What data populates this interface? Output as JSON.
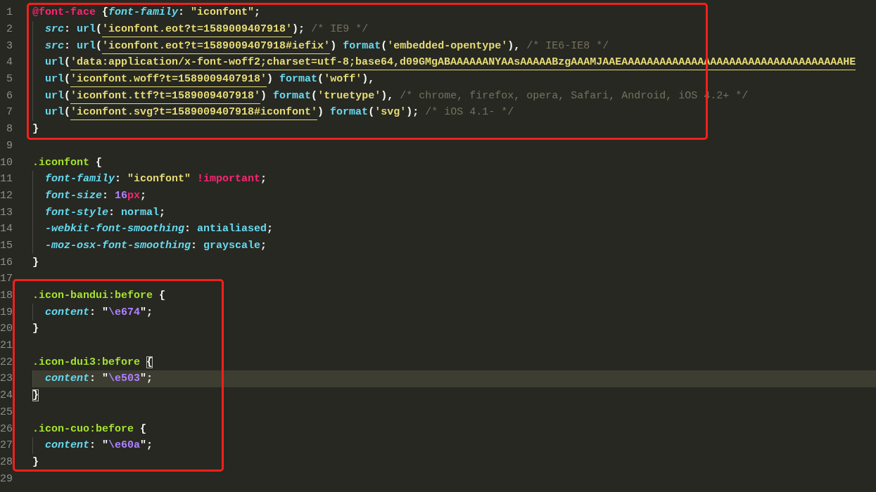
{
  "editor": {
    "groups": [
      {
        "boxed": true,
        "lines": [
          {
            "number": "1",
            "current": false,
            "indented": false,
            "tokens": [
              {
                "text": "@font-face",
                "kind": "at"
              },
              {
                "text": " {",
                "kind": "plain"
              },
              {
                "text": "font-family",
                "kind": "prop"
              },
              {
                "text": ": ",
                "kind": "plain"
              },
              {
                "text": "\"iconfont\"",
                "kind": "str"
              },
              {
                "text": ";",
                "kind": "plain"
              }
            ]
          },
          {
            "number": "2",
            "current": false,
            "indented": true,
            "tokens": [
              {
                "text": "src",
                "kind": "prop"
              },
              {
                "text": ": ",
                "kind": "plain"
              },
              {
                "text": "url",
                "kind": "func"
              },
              {
                "text": "(",
                "kind": "plain"
              },
              {
                "text": "'iconfont.eot?t=1589009407918'",
                "kind": "strmark"
              },
              {
                "text": "); ",
                "kind": "plain"
              },
              {
                "text": "/* IE9 */",
                "kind": "comment"
              }
            ]
          },
          {
            "number": "3",
            "current": false,
            "indented": true,
            "tokens": [
              {
                "text": "src",
                "kind": "prop"
              },
              {
                "text": ": ",
                "kind": "plain"
              },
              {
                "text": "url",
                "kind": "func"
              },
              {
                "text": "(",
                "kind": "plain"
              },
              {
                "text": "'iconfont.eot?t=1589009407918#iefix'",
                "kind": "strmark"
              },
              {
                "text": ") ",
                "kind": "plain"
              },
              {
                "text": "format",
                "kind": "func"
              },
              {
                "text": "(",
                "kind": "plain"
              },
              {
                "text": "'embedded-opentype'",
                "kind": "str"
              },
              {
                "text": "), ",
                "kind": "plain"
              },
              {
                "text": "/* IE6-IE8 */",
                "kind": "comment"
              }
            ]
          },
          {
            "number": "4",
            "current": false,
            "indented": true,
            "tokens": [
              {
                "text": "url",
                "kind": "func"
              },
              {
                "text": "(",
                "kind": "plain"
              },
              {
                "text": "'data:application/x-font-woff2;charset=utf-8;base64,d09GMgABAAAAAANYAAsAAAAABzgAAAMJAAEAAAAAAAAAAAAAAAAAAAAAAAAAAAAAAAAAAAHE",
                "kind": "strmark"
              }
            ]
          },
          {
            "number": "5",
            "current": false,
            "indented": true,
            "tokens": [
              {
                "text": "url",
                "kind": "func"
              },
              {
                "text": "(",
                "kind": "plain"
              },
              {
                "text": "'iconfont.woff?t=1589009407918'",
                "kind": "strmark"
              },
              {
                "text": ") ",
                "kind": "plain"
              },
              {
                "text": "format",
                "kind": "func"
              },
              {
                "text": "(",
                "kind": "plain"
              },
              {
                "text": "'woff'",
                "kind": "str"
              },
              {
                "text": "),",
                "kind": "plain"
              }
            ]
          },
          {
            "number": "6",
            "current": false,
            "indented": true,
            "tokens": [
              {
                "text": "url",
                "kind": "func"
              },
              {
                "text": "(",
                "kind": "plain"
              },
              {
                "text": "'iconfont.ttf?t=1589009407918'",
                "kind": "strmark"
              },
              {
                "text": ") ",
                "kind": "plain"
              },
              {
                "text": "format",
                "kind": "func"
              },
              {
                "text": "(",
                "kind": "plain"
              },
              {
                "text": "'truetype'",
                "kind": "str"
              },
              {
                "text": "), ",
                "kind": "plain"
              },
              {
                "text": "/* chrome, firefox, opera, Safari, Android, iOS 4.2+ */",
                "kind": "comment"
              }
            ]
          },
          {
            "number": "7",
            "current": false,
            "indented": true,
            "tokens": [
              {
                "text": "url",
                "kind": "func"
              },
              {
                "text": "(",
                "kind": "plain"
              },
              {
                "text": "'iconfont.svg?t=1589009407918#iconfont'",
                "kind": "strmark"
              },
              {
                "text": ") ",
                "kind": "plain"
              },
              {
                "text": "format",
                "kind": "func"
              },
              {
                "text": "(",
                "kind": "plain"
              },
              {
                "text": "'svg'",
                "kind": "str"
              },
              {
                "text": "); ",
                "kind": "plain"
              },
              {
                "text": "/* iOS 4.1- */",
                "kind": "comment"
              }
            ]
          },
          {
            "number": "8",
            "current": false,
            "indented": false,
            "tokens": [
              {
                "text": "}",
                "kind": "plain"
              }
            ]
          }
        ]
      },
      {
        "lines": [
          {
            "number": "9",
            "current": false,
            "indented": false
          },
          {
            "number": "10",
            "current": false,
            "indented": false,
            "tokens": [
              {
                "text": ".iconfont",
                "kind": "sel"
              },
              {
                "text": " {",
                "kind": "plain"
              }
            ]
          },
          {
            "number": "11",
            "current": false,
            "indented": true,
            "tokens": [
              {
                "text": "font-family",
                "kind": "prop"
              },
              {
                "text": ": ",
                "kind": "plain"
              },
              {
                "text": "\"iconfont\"",
                "kind": "str"
              },
              {
                "text": " !important",
                "kind": "important"
              },
              {
                "text": ";",
                "kind": "plain"
              }
            ]
          },
          {
            "number": "12",
            "current": false,
            "indented": true,
            "tokens": [
              {
                "text": "font-size",
                "kind": "prop"
              },
              {
                "text": ": ",
                "kind": "plain"
              },
              {
                "text": "16",
                "kind": "num"
              },
              {
                "text": "px",
                "kind": "unit"
              },
              {
                "text": ";",
                "kind": "plain"
              }
            ]
          },
          {
            "number": "13",
            "current": false,
            "indented": true,
            "tokens": [
              {
                "text": "font-style",
                "kind": "prop"
              },
              {
                "text": ": ",
                "kind": "plain"
              },
              {
                "text": "normal",
                "kind": "value"
              },
              {
                "text": ";",
                "kind": "plain"
              }
            ]
          },
          {
            "number": "14",
            "current": false,
            "indented": true,
            "tokens": [
              {
                "text": "-webkit-font-smoothing",
                "kind": "prop"
              },
              {
                "text": ": ",
                "kind": "plain"
              },
              {
                "text": "antialiased",
                "kind": "value"
              },
              {
                "text": ";",
                "kind": "plain"
              }
            ]
          },
          {
            "number": "15",
            "current": false,
            "indented": true,
            "tokens": [
              {
                "text": "-moz-osx-font-smoothing",
                "kind": "prop"
              },
              {
                "text": ": ",
                "kind": "plain"
              },
              {
                "text": "grayscale",
                "kind": "value"
              },
              {
                "text": ";",
                "kind": "plain"
              }
            ]
          },
          {
            "number": "16",
            "current": false,
            "indented": false,
            "tokens": [
              {
                "text": "}",
                "kind": "plain"
              }
            ]
          },
          {
            "number": "17",
            "current": false,
            "indented": false
          }
        ]
      },
      {
        "boxed": true,
        "lines": [
          {
            "number": "18",
            "current": false,
            "indented": false,
            "tokens": [
              {
                "text": ".icon-bandui:before",
                "kind": "sel"
              },
              {
                "text": " {",
                "kind": "plain"
              }
            ]
          },
          {
            "number": "19",
            "current": false,
            "indented": true,
            "tokens": [
              {
                "text": "content",
                "kind": "prop"
              },
              {
                "text": ": \"",
                "kind": "plain"
              },
              {
                "text": "\\e674",
                "kind": "escape"
              },
              {
                "text": "\";",
                "kind": "plain"
              }
            ]
          },
          {
            "number": "20",
            "current": false,
            "indented": false,
            "tokens": [
              {
                "text": "}",
                "kind": "plain"
              }
            ]
          },
          {
            "number": "21",
            "current": false,
            "indented": false
          },
          {
            "number": "22",
            "current": false,
            "indented": false,
            "tokens": [
              {
                "text": ".icon-dui3:before ",
                "kind": "sel"
              },
              {
                "text": "{",
                "kind": "match"
              }
            ]
          },
          {
            "number": "23",
            "current": true,
            "indented": true,
            "tokens": [
              {
                "text": "content",
                "kind": "prop"
              },
              {
                "text": ": \"",
                "kind": "plain"
              },
              {
                "text": "\\e503",
                "kind": "escape"
              },
              {
                "text": "\";",
                "kind": "plain"
              }
            ]
          },
          {
            "number": "24",
            "current": false,
            "indented": false,
            "tokens": [
              {
                "text": "}",
                "kind": "match"
              }
            ]
          },
          {
            "number": "25",
            "current": false,
            "indented": false
          },
          {
            "number": "26",
            "current": false,
            "indented": false,
            "tokens": [
              {
                "text": ".icon-cuo:before",
                "kind": "sel"
              },
              {
                "text": " {",
                "kind": "plain"
              }
            ]
          },
          {
            "number": "27",
            "current": false,
            "indented": true,
            "tokens": [
              {
                "text": "content",
                "kind": "prop"
              },
              {
                "text": ": \"",
                "kind": "plain"
              },
              {
                "text": "\\e60a",
                "kind": "escape"
              },
              {
                "text": "\";",
                "kind": "plain"
              }
            ]
          },
          {
            "number": "28",
            "current": false,
            "indented": false,
            "tokens": [
              {
                "text": "}",
                "kind": "plain"
              }
            ]
          }
        ]
      },
      {
        "lines": [
          {
            "number": "29",
            "current": false,
            "indented": false
          }
        ]
      }
    ]
  }
}
